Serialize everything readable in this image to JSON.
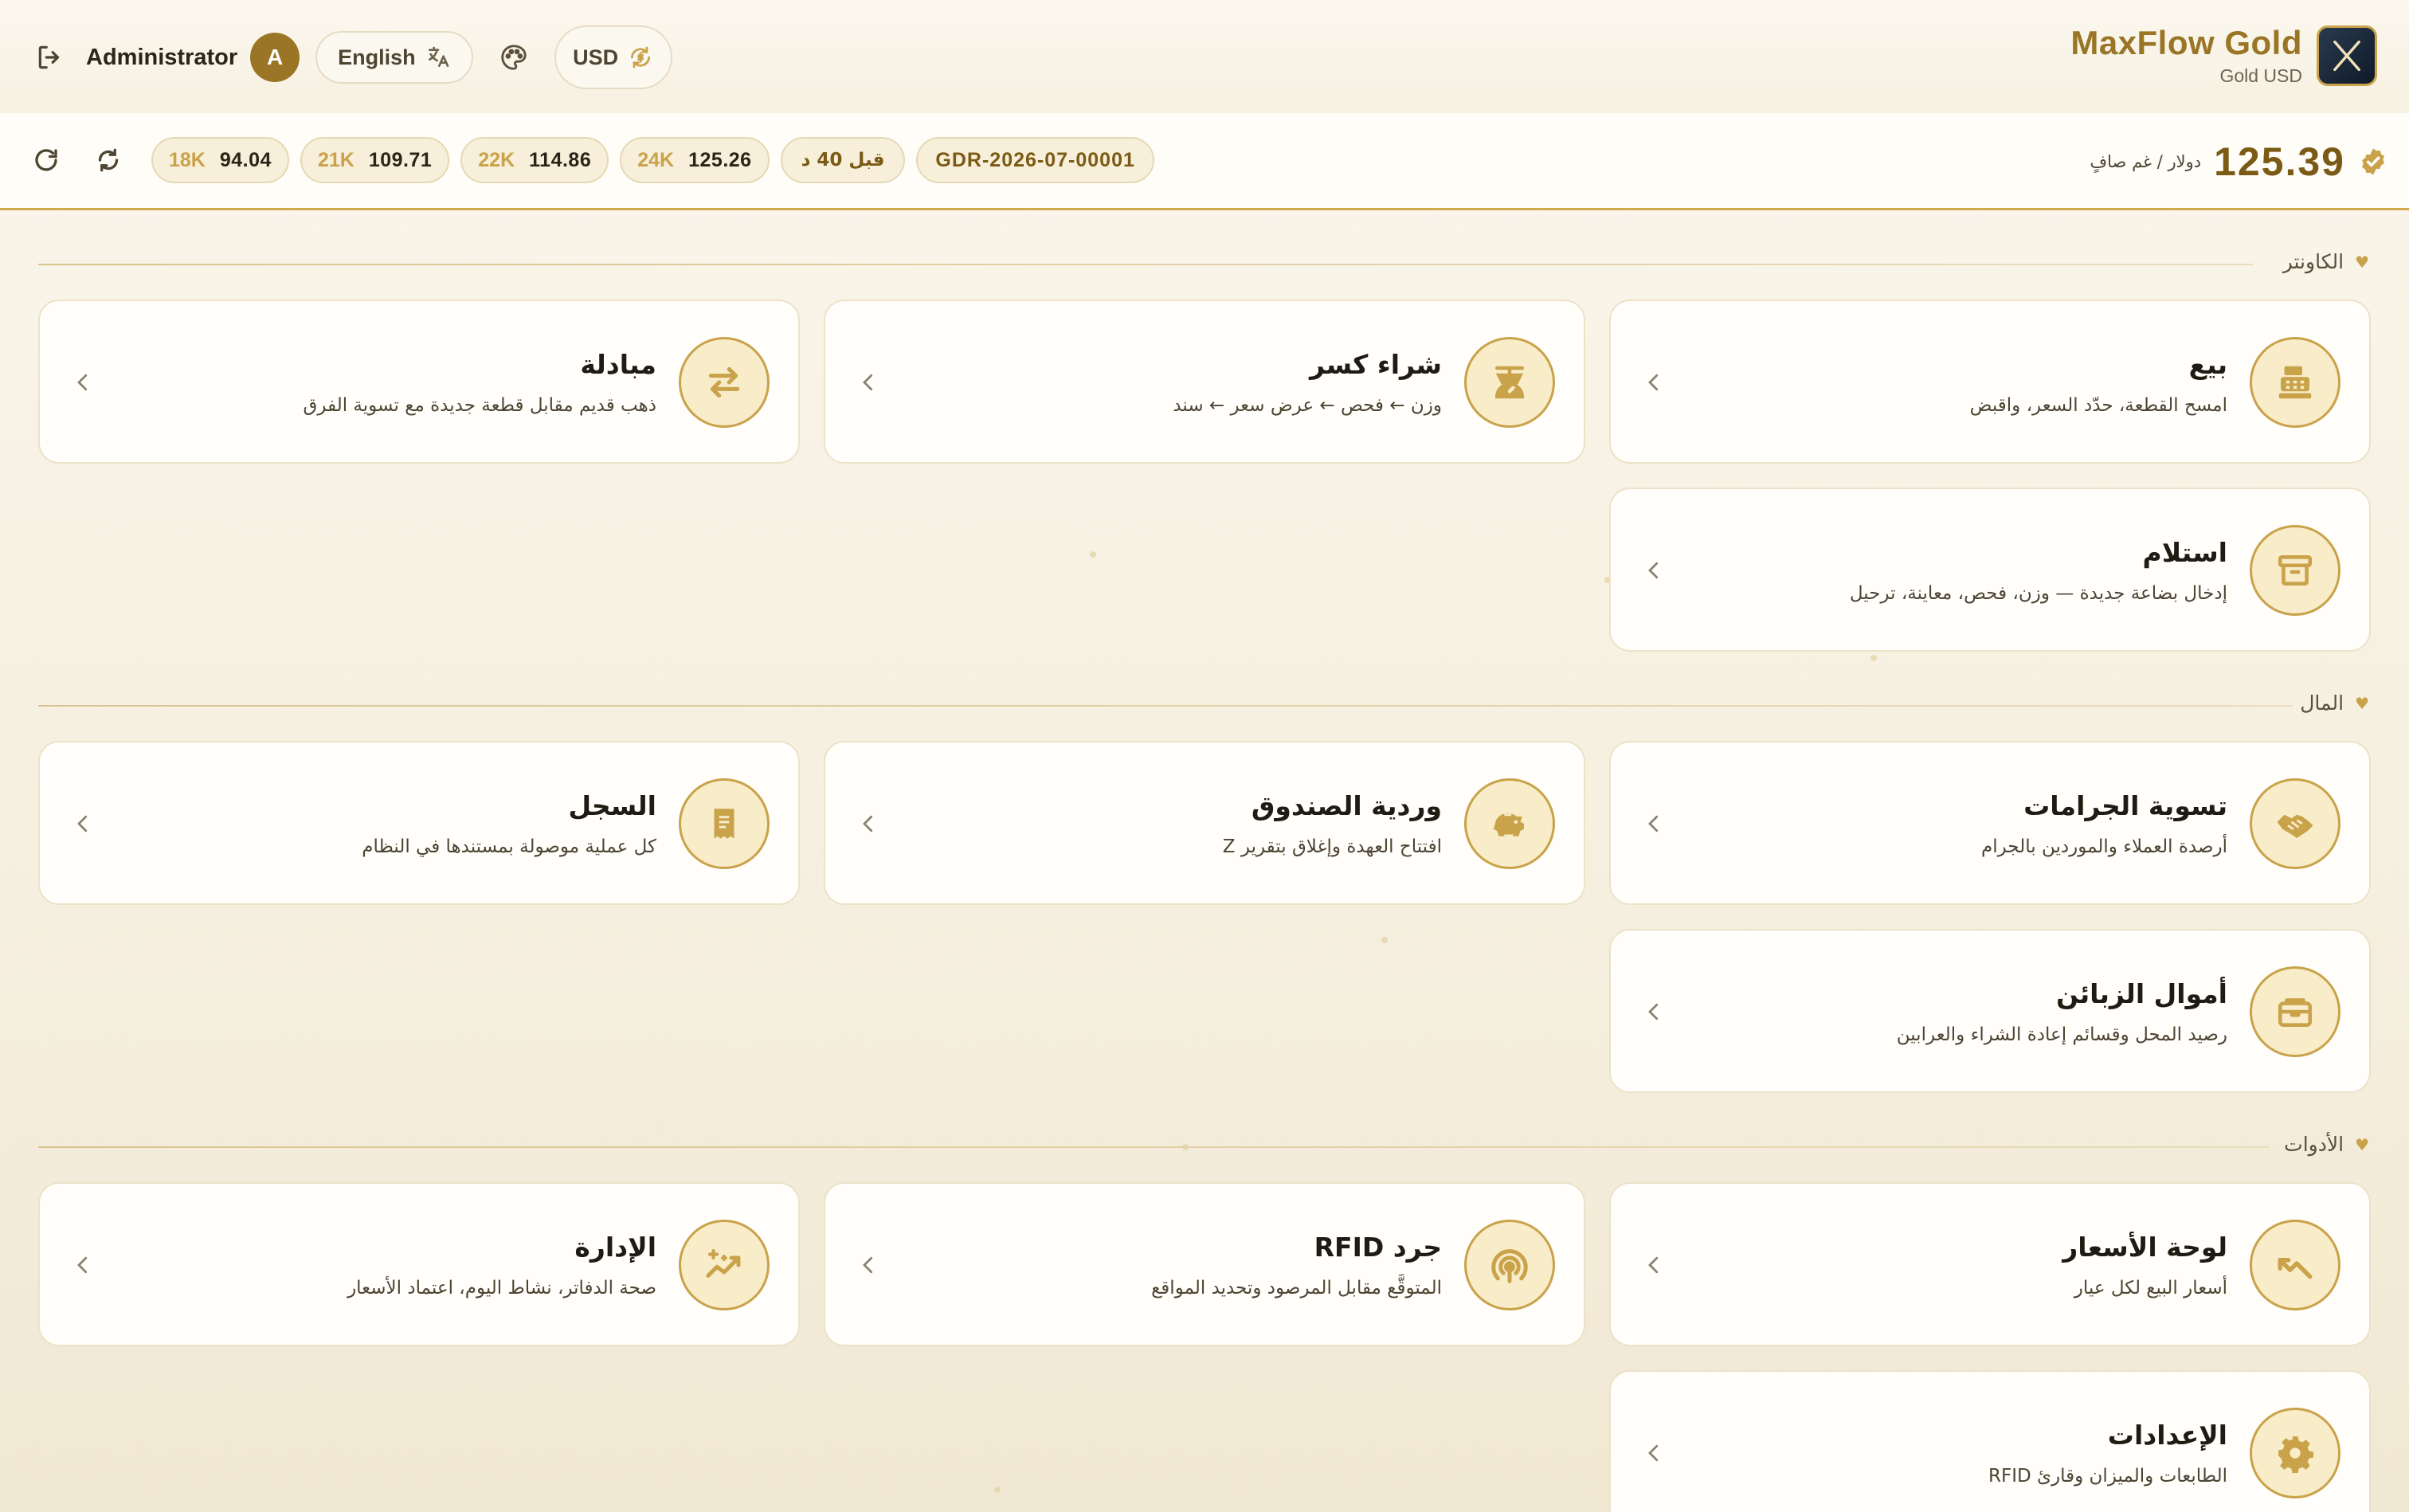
{
  "header": {
    "user_name": "Administrator",
    "avatar_initial": "A",
    "language_label": "English",
    "currency_label": "USD",
    "brand_title": "MaxFlow Gold",
    "brand_subtitle": "Gold USD"
  },
  "ticker": {
    "karats": [
      {
        "karat": "18K",
        "price": "94.04"
      },
      {
        "karat": "21K",
        "price": "109.71"
      },
      {
        "karat": "22K",
        "price": "114.86"
      },
      {
        "karat": "24K",
        "price": "125.26"
      }
    ],
    "age_label": "قبل 40 د",
    "doc_ref": "GDR-2026-07-00001",
    "price_unit": "دولار / غم صافٍ",
    "price_value": "125.39"
  },
  "sections": [
    {
      "title": "الكاونتر",
      "cards": [
        {
          "title": "بيع",
          "desc": "امسح القطعة، حدّد السعر، واقبض",
          "icon": "cash-register-icon"
        },
        {
          "title": "شراء كسر",
          "desc": "وزن ← فحص ← عرض سعر ← سند",
          "icon": "scale-icon"
        },
        {
          "title": "مبادلة",
          "desc": "ذهب قديم مقابل قطعة جديدة مع تسوية الفرق",
          "icon": "exchange-icon"
        },
        {
          "title": "استلام",
          "desc": "إدخال بضاعة جديدة — وزن، فحص، معاينة، ترحيل",
          "icon": "archive-box-icon"
        }
      ]
    },
    {
      "title": "المال",
      "cards": [
        {
          "title": "تسوية الجرامات",
          "desc": "أرصدة العملاء والموردين بالجرام",
          "icon": "handshake-icon"
        },
        {
          "title": "وردية الصندوق",
          "desc": "افتتاح العهدة وإغلاق بتقرير Z",
          "icon": "piggy-bank-icon"
        },
        {
          "title": "السجل",
          "desc": "كل عملية موصولة بمستندها في النظام",
          "icon": "receipt-icon"
        },
        {
          "title": "أموال الزبائن",
          "desc": "رصيد المحل وقسائم إعادة الشراء والعرابين",
          "icon": "wallet-icon"
        }
      ]
    },
    {
      "title": "الأدوات",
      "cards": [
        {
          "title": "لوحة الأسعار",
          "desc": "أسعار البيع لكل عيار",
          "icon": "trend-icon"
        },
        {
          "title": "جرد RFID",
          "desc": "المتوقَّع مقابل المرصود وتحديد المواقع",
          "icon": "rfid-icon"
        },
        {
          "title": "الإدارة",
          "desc": "صحة الدفاتر، نشاط اليوم، اعتماد الأسعار",
          "icon": "sparkle-chart-icon"
        },
        {
          "title": "الإعدادات",
          "desc": "الطابعات والميزان وقارئ RFID",
          "icon": "gear-icon"
        }
      ]
    }
  ]
}
